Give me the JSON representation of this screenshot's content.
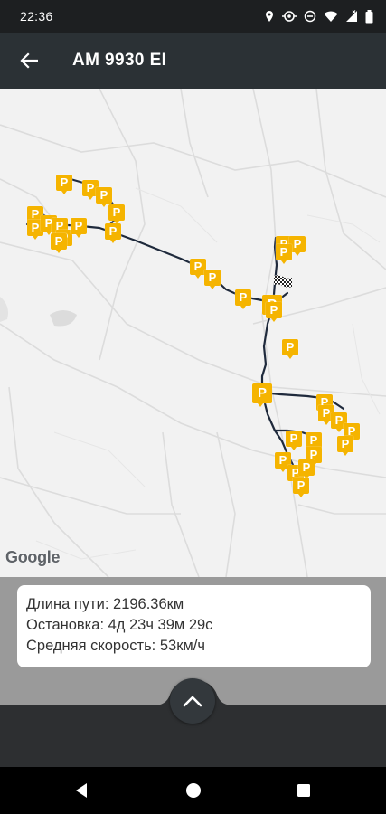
{
  "status_bar": {
    "time": "22:36",
    "icons": [
      "location-icon",
      "data-saver-icon",
      "do-not-disturb-icon",
      "wifi-icon",
      "signal-icon",
      "battery-icon"
    ]
  },
  "toolbar": {
    "back_icon": "arrow-back-icon",
    "title": "AM 9930 EI"
  },
  "map": {
    "parking_label": "P",
    "route_color": "#1f2a3c",
    "pin_color": "#f5b400",
    "attribution": "Google"
  },
  "info": {
    "distance": "Длина пути: 2196.36км",
    "stop": "Остановка: 4д 23ч 39м 29с",
    "speed": "Средняя скорость: 53км/ч"
  },
  "panel": {
    "expand_icon": "chevron-up-icon"
  },
  "nav": {
    "back": "nav-back-icon",
    "home": "nav-home-icon",
    "recents": "nav-recents-icon"
  }
}
